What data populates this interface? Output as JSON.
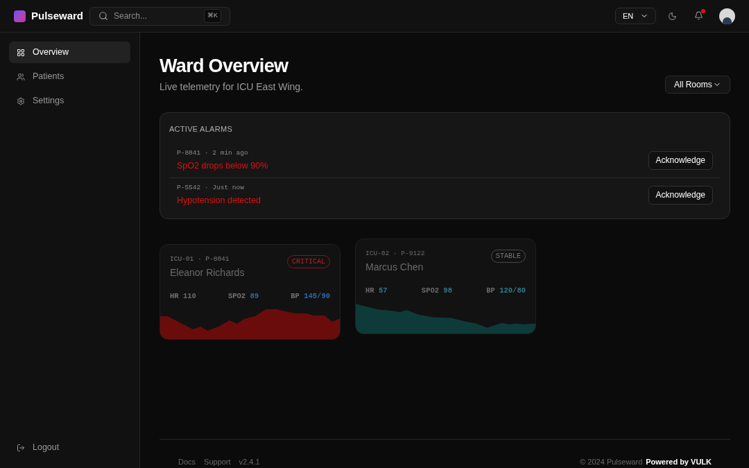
{
  "brand": {
    "name": "Pulseward"
  },
  "search": {
    "placeholder": "Search...",
    "shortcut": "⌘K"
  },
  "header": {
    "language": "EN",
    "notifications_unread": true
  },
  "sidebar": {
    "items": [
      {
        "label": "Overview",
        "selected": true
      },
      {
        "label": "Patients",
        "selected": false
      },
      {
        "label": "Settings",
        "selected": false
      }
    ],
    "logout": "Logout"
  },
  "page": {
    "title": "Ward Overview",
    "subtitle": "Live telemetry for ICU East Wing.",
    "room_filter": "All Rooms"
  },
  "alarms": {
    "title": "ACTIVE ALARMS",
    "items": [
      {
        "meta": "P-8041 · 2 min ago",
        "message": "SpO2 drops below 90%",
        "action": "Acknowledge"
      },
      {
        "meta": "P-5542 · Just now",
        "message": "Hypotension detected",
        "action": "Acknowledge"
      }
    ]
  },
  "patients": [
    {
      "meta": "ICU-01 · P-8041",
      "name": "Eleanor Richards",
      "status": "CRITICAL",
      "kind": "critical",
      "vitals": [
        {
          "label": "HR",
          "value": "110"
        },
        {
          "label": "SPO2",
          "value": "89"
        },
        {
          "label": "BP",
          "value": "145/90"
        }
      ]
    },
    {
      "meta": "ICU-02 · P-9122",
      "name": "Marcus Chen",
      "status": "STABLE",
      "kind": "stable",
      "vitals": [
        {
          "label": "HR",
          "value": "57"
        },
        {
          "label": "SPO2",
          "value": "98"
        },
        {
          "label": "BP",
          "value": "120/80"
        }
      ]
    }
  ],
  "footer": {
    "links": [
      "Docs",
      "Support",
      "v2.4.1"
    ],
    "copyright": "© 2024 Pulseward",
    "powered": "Powered by VULK"
  }
}
